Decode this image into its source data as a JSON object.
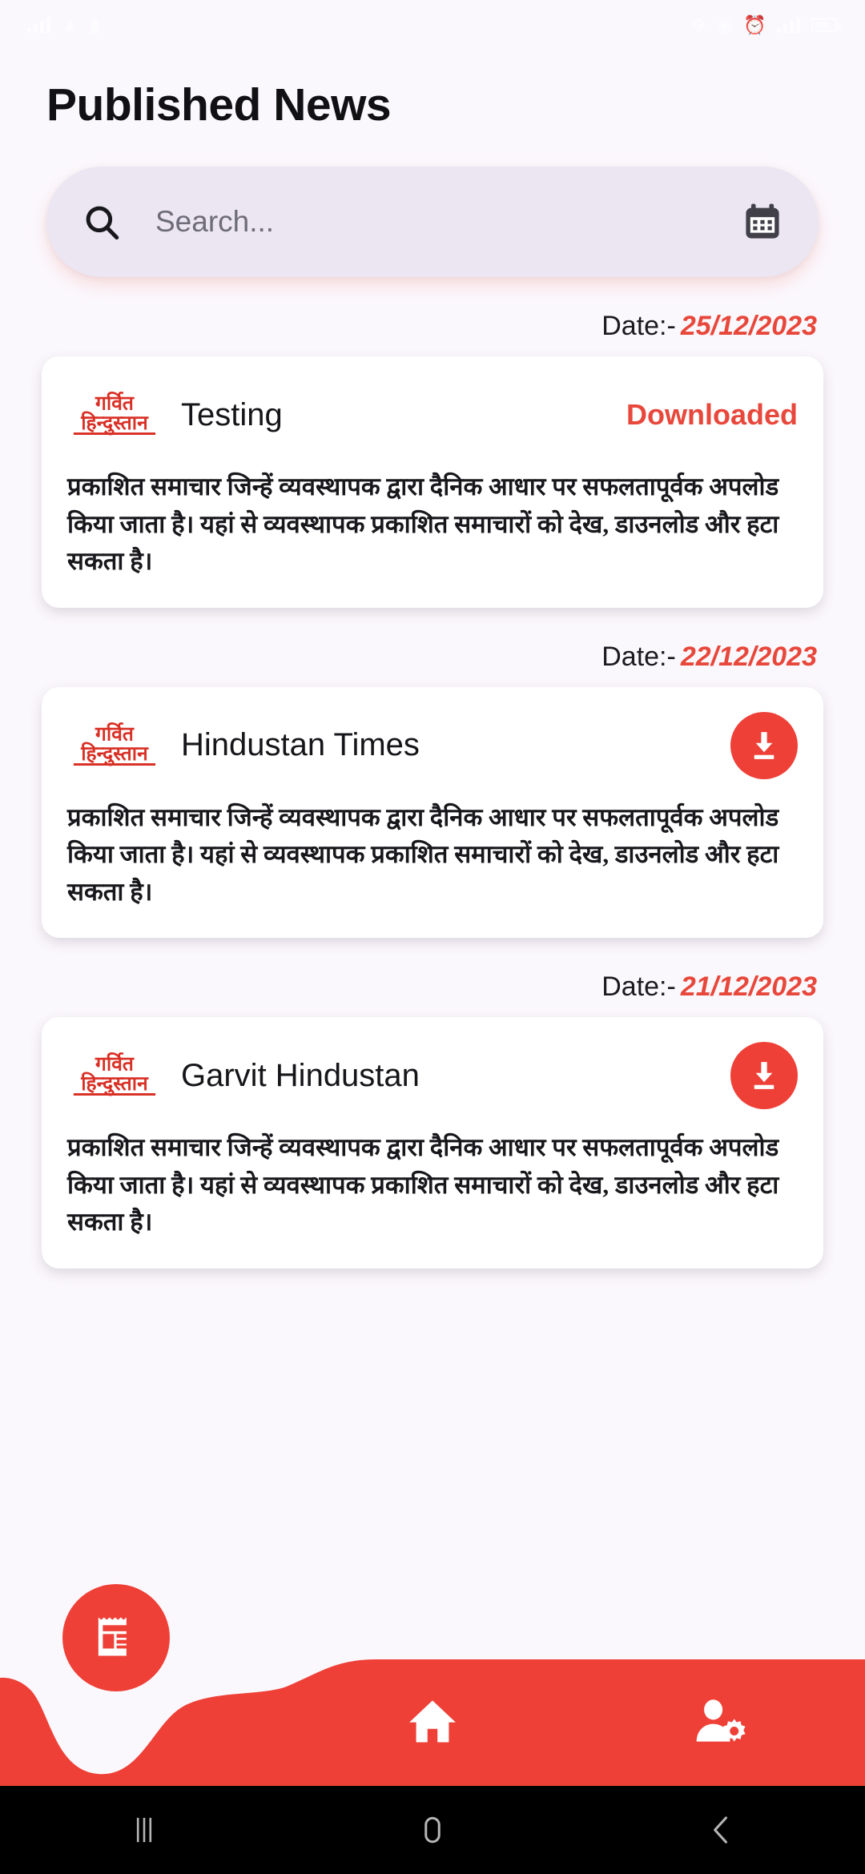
{
  "statusbar": {
    "left_icons": [
      "signal-bars-icon",
      "wifi-icon",
      "vibrate-icon"
    ],
    "right_icons": [
      "bluetooth-icon",
      "nfc-icon",
      "alarm-icon",
      "signal-icon",
      "wifi-icon",
      "battery-icon"
    ],
    "time": ""
  },
  "header": {
    "title": "Published News"
  },
  "search": {
    "value": "",
    "placeholder": "Search...",
    "search_icon": "search-icon",
    "calendar_icon": "calendar-icon"
  },
  "colors": {
    "accent_red": "#ee4037",
    "status_red": "#e8483b",
    "page_bg": "#fbf8fd",
    "search_bg": "#ebe6f2",
    "card_bg": "#ffffff",
    "text_dark": "#16161a",
    "calendar_icon": "#414049",
    "sysbar_bg": "#000000"
  },
  "list": {
    "date_label": "Date:-",
    "body_text": "प्रकाशित समाचार जिन्हें व्यवस्थापक द्वारा दैनिक आधार पर सफलतापूर्वक अपलोड किया जाता है। यहां से व्यवस्थापक प्रकाशित समाचारों को देख, डाउनलोड और हटा सकता है।",
    "brand_logo_line1": "गर्वित",
    "brand_logo_line2": "हिन्दुस्तान",
    "items": [
      {
        "date": "25/12/2023",
        "title": "Testing",
        "status": "Downloaded",
        "action": "status",
        "body": "प्रकाशित समाचार जिन्हें व्यवस्थापक द्वारा दैनिक आधार पर सफलतापूर्वक अपलोड किया जाता है। यहां से व्यवस्थापक प्रकाशित समाचारों को देख, डाउनलोड और हटा सकता है।"
      },
      {
        "date": "22/12/2023",
        "title": "Hindustan Times",
        "status": "",
        "action": "download",
        "body": "प्रकाशित समाचार जिन्हें व्यवस्थापक द्वारा दैनिक आधार पर सफलतापूर्वक अपलोड किया जाता है। यहां से व्यवस्थापक प्रकाशित समाचारों को देख, डाउनलोड और हटा सकता है।"
      },
      {
        "date": "21/12/2023",
        "title": "Garvit Hindustan",
        "status": "",
        "action": "download",
        "body": "प्रकाशित समाचार जिन्हें व्यवस्थापक द्वारा दैनिक आधार पर सफलतापूर्वक अपलोड किया जाता है। यहां से व्यवस्थापक प्रकाशित समाचारों को देख, डाउनलोड और हटा सकता है।"
      }
    ]
  },
  "bottom_nav": {
    "items": [
      {
        "icon": "newspaper-icon",
        "label": "",
        "active": true
      },
      {
        "icon": "home-icon",
        "label": "",
        "active": false
      },
      {
        "icon": "user-settings-icon",
        "label": "",
        "active": false
      }
    ]
  },
  "system_nav": {
    "recents_icon": "recents-icon",
    "home_icon": "home-circle-icon",
    "back_icon": "back-chevron-icon"
  }
}
